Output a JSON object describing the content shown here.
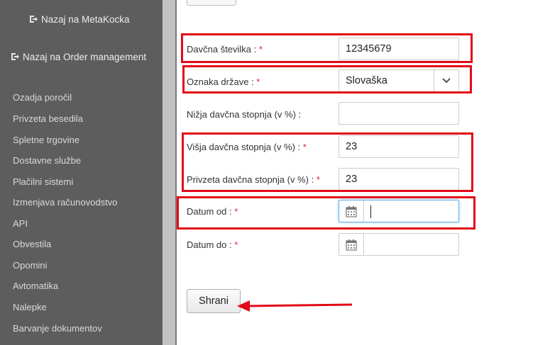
{
  "sidebar": {
    "back_links": [
      {
        "label": "Nazaj na MetaKocka",
        "icon": "external-link-icon"
      },
      {
        "label": "Nazaj na Order management",
        "icon": "external-link-icon"
      }
    ],
    "items": [
      {
        "label": "Ozadja poročil"
      },
      {
        "label": "Privzeta besedila"
      },
      {
        "label": "Spletne trgovine"
      },
      {
        "label": "Dostavne službe"
      },
      {
        "label": "Plačilni sistemi"
      },
      {
        "label": "Izmenjava računovodstvo"
      },
      {
        "label": "API"
      },
      {
        "label": "Obvestila"
      },
      {
        "label": "Opomini"
      },
      {
        "label": "Avtomatika"
      },
      {
        "label": "Nalepke"
      },
      {
        "label": "Barvanje dokumentov"
      }
    ]
  },
  "form": {
    "required_marker": "*",
    "fields": {
      "tax_number": {
        "label": "Davčna številka :",
        "value": "12345679"
      },
      "country": {
        "label": "Oznaka države :",
        "value": "Slovaška"
      },
      "lower_rate": {
        "label": "Nižja davčna stopnja (v %) :",
        "value": ""
      },
      "higher_rate": {
        "label": "Višja davčna stopnja (v %) :",
        "value": "23"
      },
      "default_rate": {
        "label": "Privzeta davčna stopnja (v %) :",
        "value": "23"
      },
      "date_from": {
        "label": "Datum od :",
        "value": ""
      },
      "date_to": {
        "label": "Datum do :",
        "value": ""
      }
    },
    "save_label": "Shrani"
  },
  "colors": {
    "sidebar_bg": "#5d5d5d",
    "highlight": "#e20a17",
    "required": "#e0242b",
    "focus_border": "#66afe9"
  }
}
